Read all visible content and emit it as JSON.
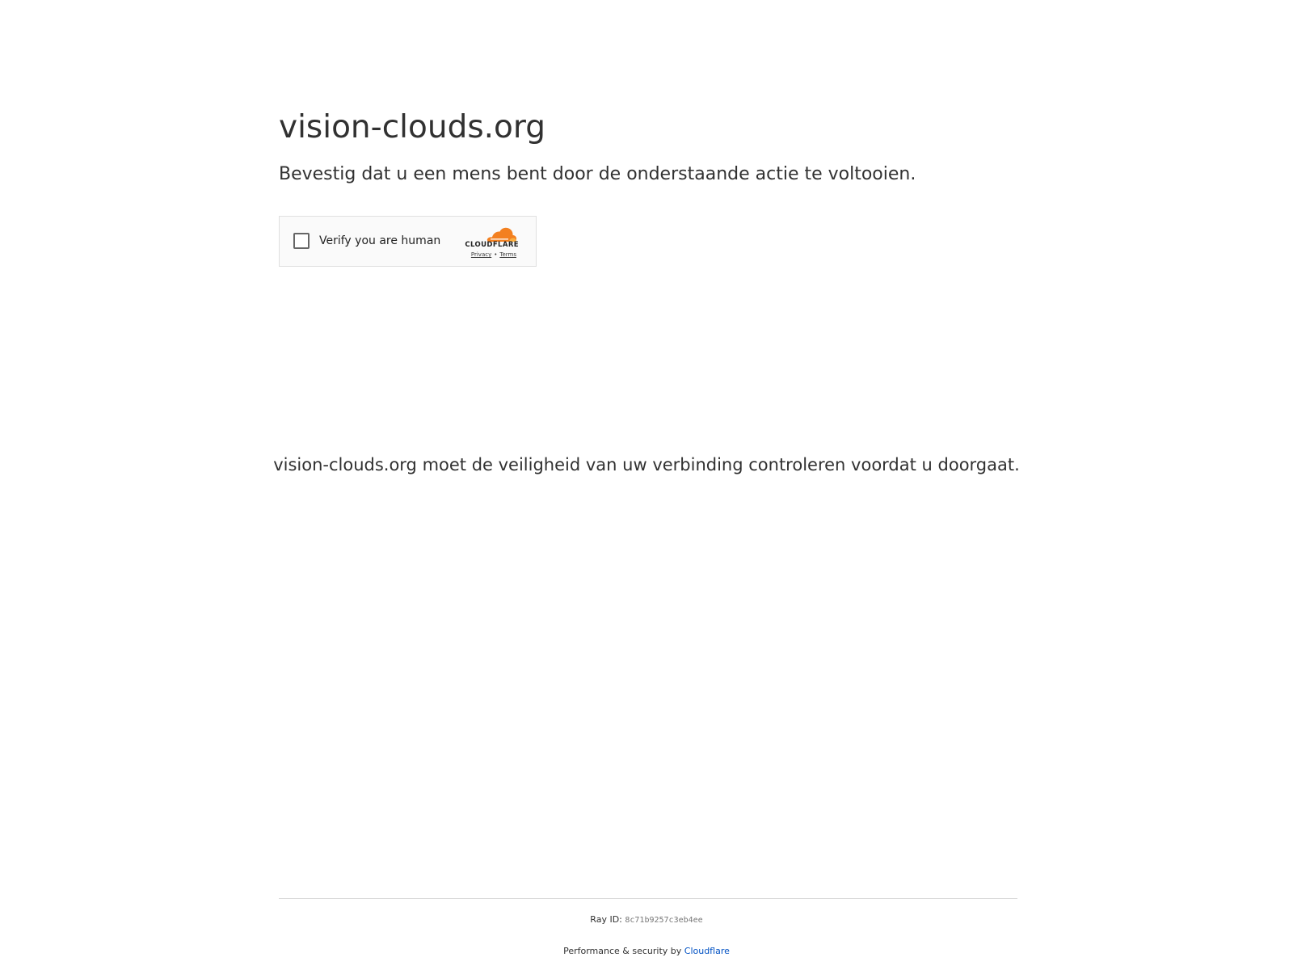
{
  "header": {
    "title": "vision-clouds.org",
    "subtitle": "Bevestig dat u een mens bent door de onderstaande actie te voltooien."
  },
  "challenge_widget": {
    "checkbox_label": "Verify you are human",
    "checked": false,
    "brand_name": "CLOUDFLARE",
    "privacy_link": "Privacy",
    "separator": "•",
    "terms_link": "Terms",
    "brand_color_orange": "#f38020",
    "brand_color_light_orange": "#faae40",
    "icons": [
      "checkbox-icon",
      "cloudflare-cloud-logo-icon"
    ]
  },
  "main": {
    "security_message": "vision-clouds.org moet de veiligheid van uw verbinding controleren voordat u doorgaat."
  },
  "footer": {
    "ray_label": "Ray ID:",
    "ray_id": "8c71b9257c3eb4ee",
    "performance_prefix": "Performance & security by",
    "cloudflare_link": "Cloudflare",
    "link_color": "#0051c3"
  }
}
